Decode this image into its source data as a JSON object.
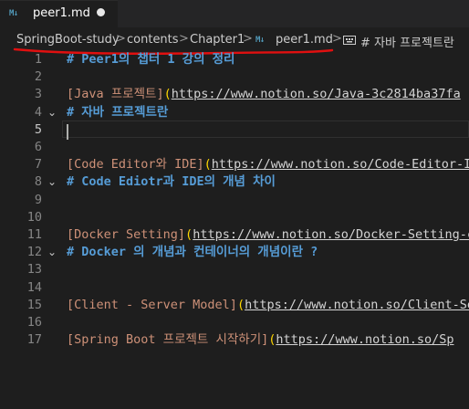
{
  "tab": {
    "icon": "markdown-icon",
    "label": "peer1.md",
    "dirty": true
  },
  "breadcrumb": {
    "items": [
      "SpringBoot-study",
      "contents",
      "Chapter1",
      "peer1.md",
      "# 자바 프로젝트란"
    ],
    "separator": ">"
  },
  "colors": {
    "background": "#1e1e1e",
    "heading": "#569cd6",
    "link_text": "#ce9178",
    "bracket": "#ffd700",
    "annotation": "#e01010"
  },
  "editor": {
    "active_line": "5",
    "lines": [
      {
        "n": "1",
        "type": "heading",
        "text": "# Peer1의 챕터 1 강의 정리"
      },
      {
        "n": "2",
        "type": "empty"
      },
      {
        "n": "3",
        "type": "link",
        "label": "[Java 프로젝트]",
        "open": "(",
        "url": "https://www.notion.so/Java-3c2814ba37fa"
      },
      {
        "n": "4",
        "type": "heading",
        "text": "# 자바 프로젝트란",
        "fold": true
      },
      {
        "n": "5",
        "type": "empty"
      },
      {
        "n": "6",
        "type": "empty"
      },
      {
        "n": "7",
        "type": "link",
        "label": "[Code Editor와 IDE]",
        "open": "(",
        "url": "https://www.notion.so/Code-Editor-I"
      },
      {
        "n": "8",
        "type": "heading",
        "text": "# Code Ediotr과 IDE의 개념 차이",
        "fold": true
      },
      {
        "n": "9",
        "type": "empty"
      },
      {
        "n": "10",
        "type": "empty"
      },
      {
        "n": "11",
        "type": "link",
        "label": "[Docker Setting]",
        "open": "(",
        "url": "https://www.notion.so/Docker-Setting-c"
      },
      {
        "n": "12",
        "type": "heading",
        "text": "# Docker 의 개념과 컨테이너의 개념이란 ?",
        "fold": true
      },
      {
        "n": "13",
        "type": "empty"
      },
      {
        "n": "14",
        "type": "empty"
      },
      {
        "n": "15",
        "type": "link",
        "label": "[Client - Server Model]",
        "open": "(",
        "url": "https://www.notion.so/Client-Se"
      },
      {
        "n": "16",
        "type": "empty"
      },
      {
        "n": "17",
        "type": "link",
        "label": "[Spring Boot 프로젝트 시작하기]",
        "open": "(",
        "url": "https://www.notion.so/Sp"
      }
    ]
  }
}
